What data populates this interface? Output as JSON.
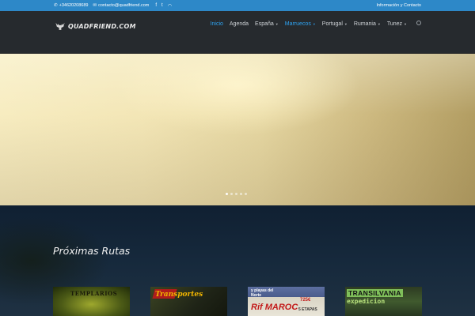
{
  "topbar": {
    "phone": "+34620208689",
    "email": "contacto@quadfriend.com",
    "right_link": "Información y Contacto",
    "social_icons": [
      "facebook-icon",
      "twitter-icon",
      "rss-icon"
    ]
  },
  "header": {
    "logo_text": "QUADFRIEND.COM",
    "nav": [
      {
        "label": "Inicio",
        "active": true,
        "dropdown": false
      },
      {
        "label": "Agenda",
        "active": false,
        "dropdown": false
      },
      {
        "label": "España",
        "active": false,
        "dropdown": true
      },
      {
        "label": "Marruecos",
        "active": true,
        "dropdown": true
      },
      {
        "label": "Portugal",
        "active": false,
        "dropdown": true
      },
      {
        "label": "Rumania",
        "active": false,
        "dropdown": true
      },
      {
        "label": "Tunez",
        "active": false,
        "dropdown": true
      }
    ]
  },
  "hero": {
    "slides": 5,
    "active_slide": 1
  },
  "routes": {
    "title": "Próximas Rutas",
    "cards": [
      {
        "title": "TEMPLARIOS"
      },
      {
        "title": "Transportes"
      },
      {
        "line1": "y playas del",
        "line2": "Norte",
        "price": "725€",
        "brand": "Rif MAROC",
        "extra": "5 ETAPAS"
      },
      {
        "line1": "TRANSILVANIA",
        "line2": "expedicion"
      }
    ]
  },
  "colors": {
    "topbar": "#2d88c8",
    "header": "#262a2e",
    "accent": "#2ea3f2"
  }
}
